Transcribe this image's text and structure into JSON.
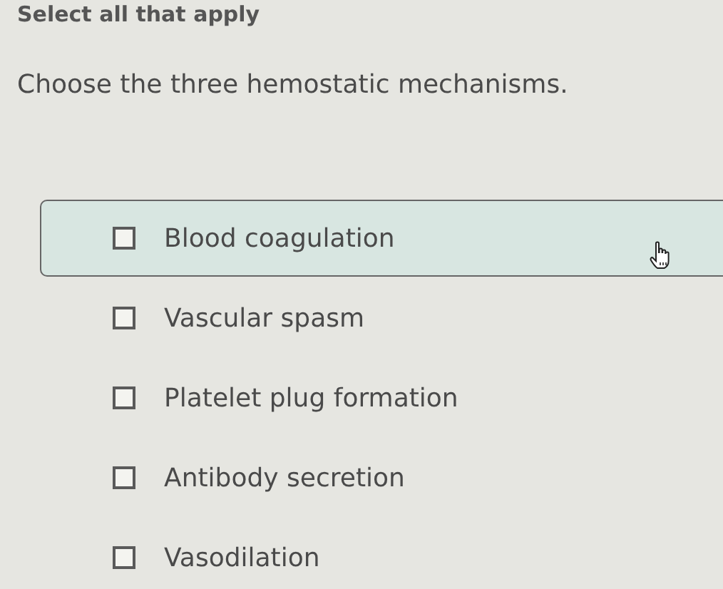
{
  "instruction": "Select all that apply",
  "question": "Choose the three hemostatic mechanisms.",
  "options": [
    {
      "label": "Blood coagulation",
      "checked": false,
      "hovered": true
    },
    {
      "label": "Vascular spasm",
      "checked": false,
      "hovered": false
    },
    {
      "label": "Platelet plug formation",
      "checked": false,
      "hovered": false
    },
    {
      "label": "Antibody secretion",
      "checked": false,
      "hovered": false
    },
    {
      "label": "Vasodilation",
      "checked": false,
      "hovered": false
    }
  ]
}
